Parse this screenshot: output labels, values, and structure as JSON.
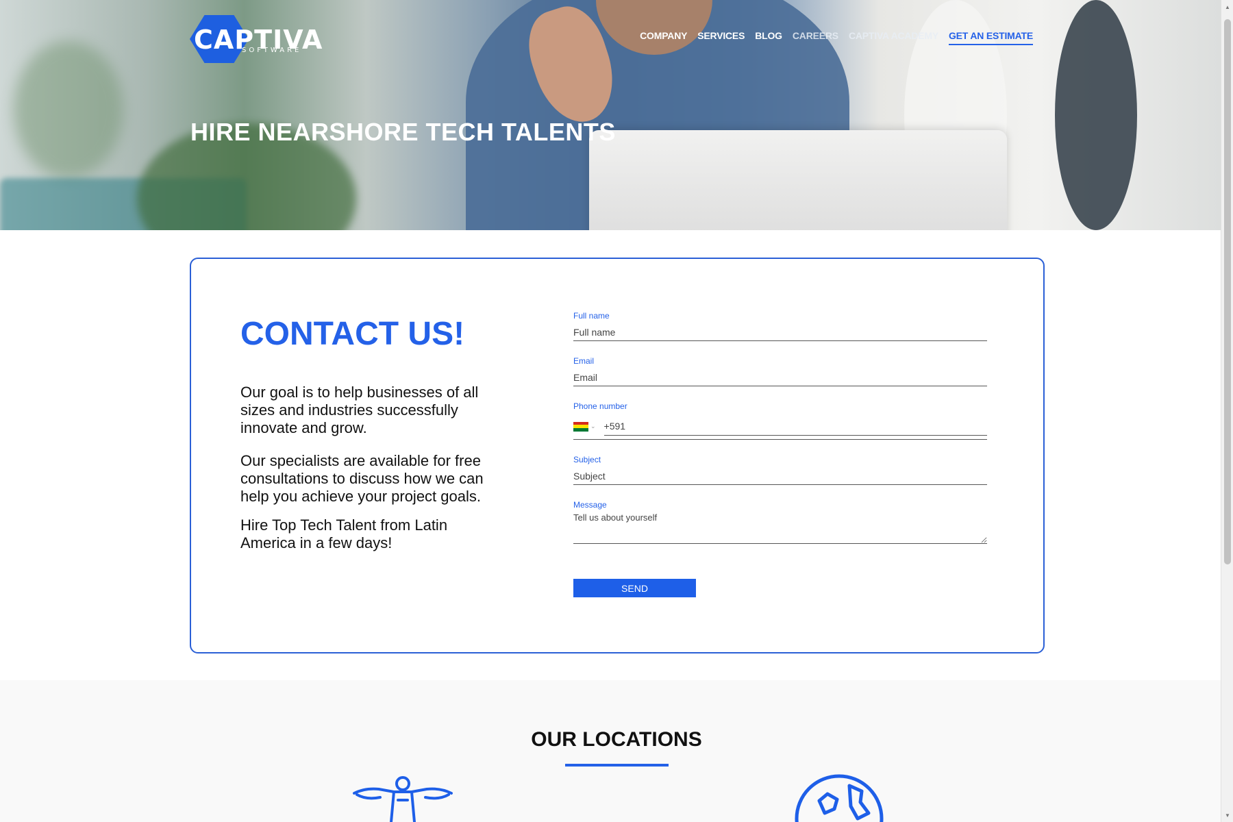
{
  "header": {
    "logo_text": "CAPTIVA",
    "logo_subtext": "SOFTWARE",
    "nav": [
      {
        "label": "COMPANY"
      },
      {
        "label": "SERVICES"
      },
      {
        "label": "BLOG"
      },
      {
        "label": "CAREERS"
      },
      {
        "label": "CAPTIVA ACADEMY"
      },
      {
        "label": "GET AN ESTIMATE"
      }
    ]
  },
  "hero": {
    "title": "HIRE NEARSHORE TECH TALENTS"
  },
  "contact": {
    "title": "CONTACT US!",
    "paragraphs": [
      "Our goal is to help businesses of all sizes and industries successfully innovate and grow.",
      "Our specialists are available for free consultations to discuss how we can help you achieve your project goals.",
      "Hire Top Tech Talent from Latin America in a few days!"
    ],
    "form": {
      "fullname_label": "Full name",
      "fullname_placeholder": "Full name",
      "email_label": "Email",
      "email_placeholder": "Email",
      "phone_label": "Phone number",
      "phone_placeholder": "+591",
      "subject_label": "Subject",
      "subject_placeholder": "Subject",
      "message_label": "Message",
      "message_placeholder": "Tell us about yourself",
      "send_label": "SEND"
    }
  },
  "locations": {
    "title": "OUR LOCATIONS"
  },
  "colors": {
    "accent": "#2461e8",
    "card_border": "#2a5fd6",
    "flag_red": "#d52b1e",
    "flag_yellow": "#f9e300",
    "flag_green": "#007934"
  },
  "icons": [
    "christ-the-redeemer-icon",
    "globe-icon",
    "chevron-down-icon"
  ]
}
